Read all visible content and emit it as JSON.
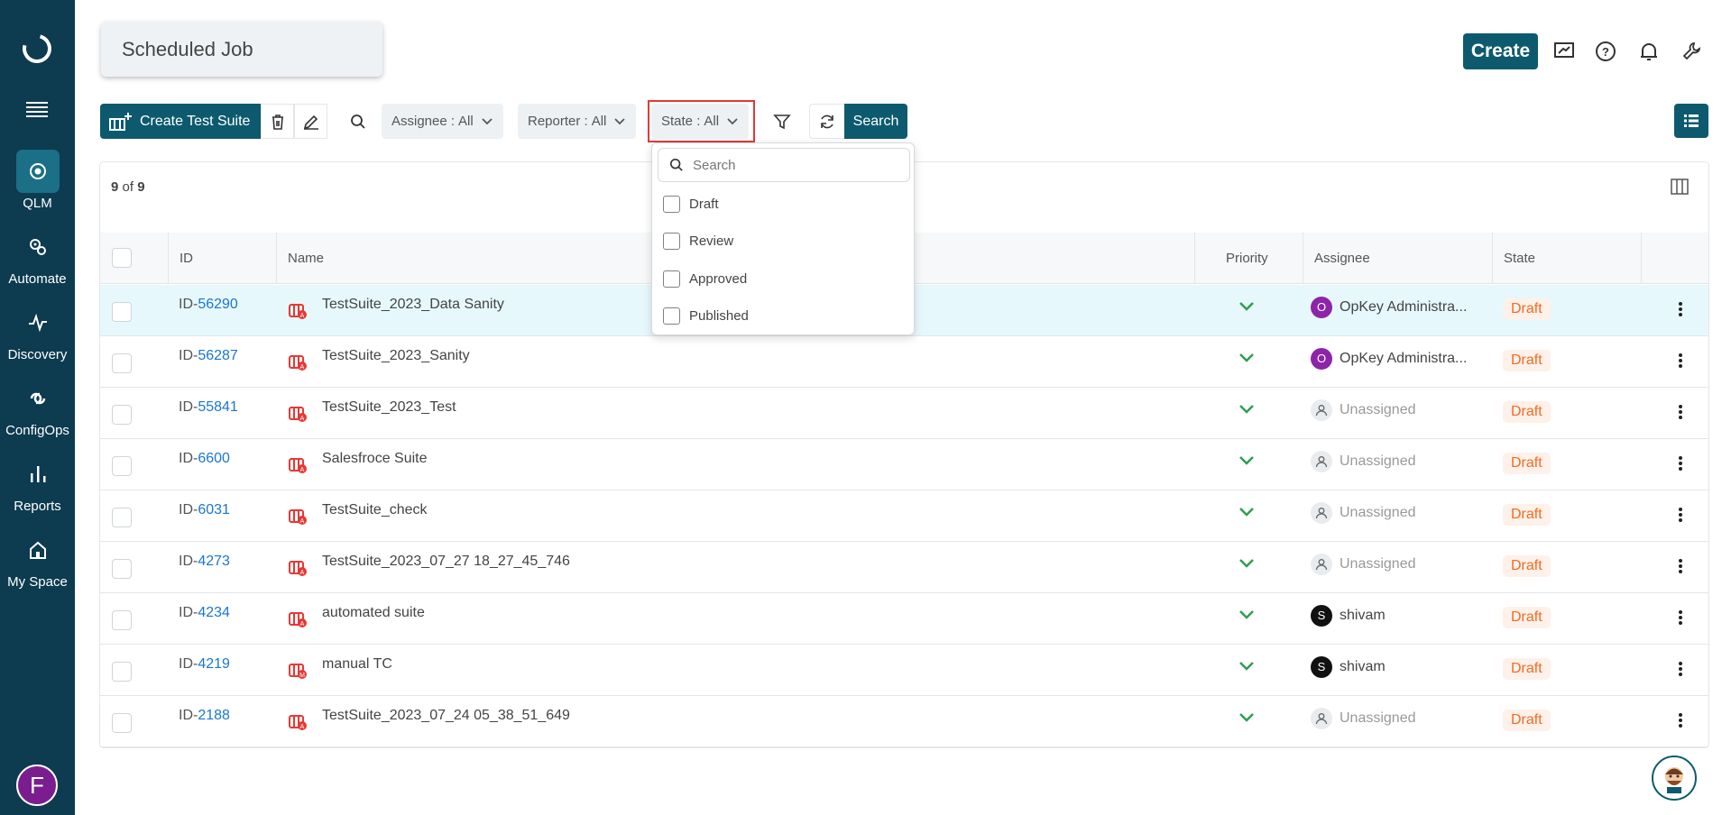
{
  "sidebar": {
    "items": [
      {
        "label": "QLM",
        "icon": "qlm-icon",
        "active": true
      },
      {
        "label": "Automate",
        "icon": "automate-icon"
      },
      {
        "label": "Discovery",
        "icon": "discovery-icon"
      },
      {
        "label": "ConfigOps",
        "icon": "configops-icon"
      },
      {
        "label": "Reports",
        "icon": "reports-icon"
      },
      {
        "label": "My Space",
        "icon": "home-icon"
      }
    ],
    "user_initial": "F"
  },
  "header": {
    "title": "Scheduled Job",
    "create_label": "Create"
  },
  "toolbar": {
    "create_suite_label": "Create Test Suite",
    "assignee_label": "Assignee :",
    "assignee_value": "All",
    "reporter_label": "Reporter :",
    "reporter_value": "All",
    "state_label": "State :",
    "state_value": "All",
    "search_label": "Search"
  },
  "state_dropdown": {
    "placeholder": "Search",
    "options": [
      "Draft",
      "Review",
      "Approved",
      "Published"
    ]
  },
  "table": {
    "count_current": "9",
    "count_of": "of",
    "count_total": "9",
    "headers": {
      "id": "ID",
      "name": "Name",
      "priority": "Priority",
      "assignee": "Assignee",
      "state": "State"
    },
    "rows": [
      {
        "id_prefix": "ID-",
        "id_num": "56290",
        "name": "TestSuite_2023_Data Sanity",
        "assignee": "OpKey Administra...",
        "assignee_initial": "O",
        "assignee_type": "user",
        "state": "Draft"
      },
      {
        "id_prefix": "ID-",
        "id_num": "56287",
        "name": "TestSuite_2023_Sanity",
        "assignee": "OpKey Administra...",
        "assignee_initial": "O",
        "assignee_type": "user",
        "state": "Draft"
      },
      {
        "id_prefix": "ID-",
        "id_num": "55841",
        "name": "TestSuite_2023_Test",
        "assignee": "Unassigned",
        "assignee_type": "none",
        "state": "Draft"
      },
      {
        "id_prefix": "ID-",
        "id_num": "6600",
        "name": "Salesfroce Suite",
        "assignee": "Unassigned",
        "assignee_type": "none",
        "state": "Draft"
      },
      {
        "id_prefix": "ID-",
        "id_num": "6031",
        "name": "TestSuite_check",
        "assignee": "Unassigned",
        "assignee_type": "none",
        "state": "Draft"
      },
      {
        "id_prefix": "ID-",
        "id_num": "4273",
        "name": "TestSuite_2023_07_27 18_27_45_746",
        "assignee": "Unassigned",
        "assignee_type": "none",
        "state": "Draft"
      },
      {
        "id_prefix": "ID-",
        "id_num": "4234",
        "name": "automated suite",
        "assignee": "shivam",
        "assignee_initial": "S",
        "assignee_type": "user2",
        "state": "Draft"
      },
      {
        "id_prefix": "ID-",
        "id_num": "4219",
        "name": "manual TC",
        "assignee": "shivam",
        "assignee_initial": "S",
        "assignee_type": "user2",
        "state": "Draft"
      },
      {
        "id_prefix": "ID-",
        "id_num": "2188",
        "name": "TestSuite_2023_07_24 05_38_51_649",
        "assignee": "Unassigned",
        "assignee_type": "none",
        "state": "Draft"
      }
    ]
  },
  "colors": {
    "sidebar": "#0d3b4f",
    "primary": "#0d5a6e",
    "draft": "#f26b22",
    "link": "#1976d2",
    "priority": "#2e9e4f"
  }
}
